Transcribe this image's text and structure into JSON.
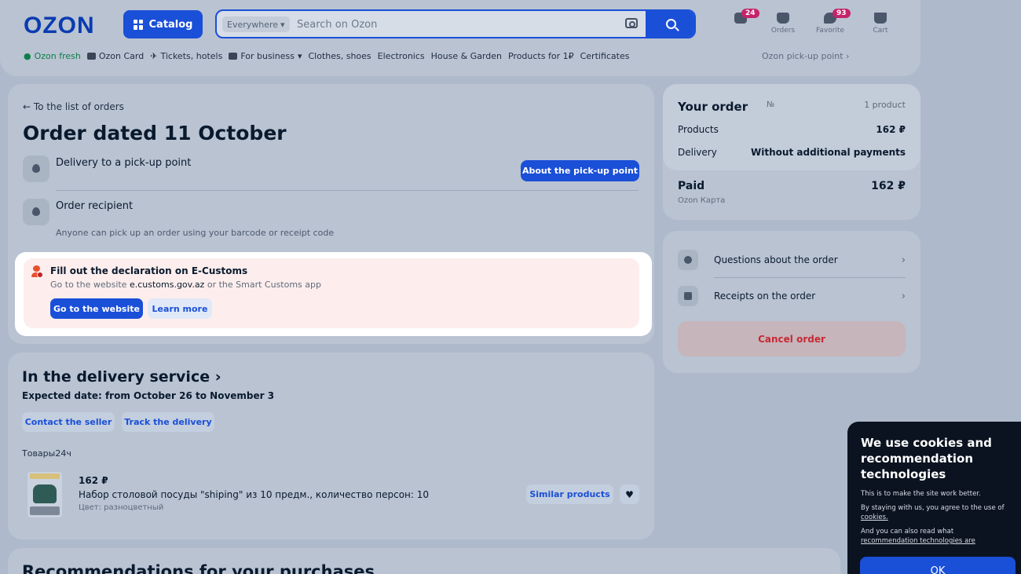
{
  "header": {
    "logo": "OZON",
    "catalog_label": "Catalog",
    "search_scope": "Everywhere",
    "search_placeholder": "Search on Ozon",
    "icons": [
      {
        "label": "",
        "badge": "24",
        "icon": "chat-icon"
      },
      {
        "label": "Orders",
        "badge": "",
        "icon": "box-icon"
      },
      {
        "label": "Favorite",
        "badge": "93",
        "icon": "heart-icon"
      },
      {
        "label": "Cart",
        "badge": "",
        "icon": "cart-icon"
      }
    ],
    "nav": [
      "Ozon fresh",
      "Ozon Card",
      "Tickets, hotels",
      "For business",
      "Clothes, shoes",
      "Electronics",
      "House & Garden",
      "Products for 1₽",
      "Certificates"
    ],
    "pickup": "Ozon pick-up point"
  },
  "order": {
    "back": "To the list of orders",
    "title": "Order dated 11 October",
    "delivery_label": "Delivery to a pick-up point",
    "about_button": "About the pick-up point",
    "recipient_label": "Order recipient",
    "recipient_sub": "Anyone can pick up an order using your barcode or receipt code"
  },
  "customs": {
    "title": "Fill out the declaration on E-Customs",
    "desc_pre": "Go to the website",
    "desc_site": "e.customs.gov.az",
    "desc_post": "or the Smart Customs app",
    "go_button": "Go to the website",
    "learn_button": "Learn more"
  },
  "summary": {
    "title": "Your order",
    "number_label": "№",
    "count": "1 product",
    "products_label": "Products",
    "products_value": "162 ₽",
    "delivery_label": "Delivery",
    "delivery_value": "Without additional payments",
    "paid_label": "Paid",
    "paid_value": "162 ₽",
    "paid_method": "Ozon Карта"
  },
  "help": {
    "questions": "Questions about the order",
    "receipts": "Receipts on the order",
    "cancel": "Cancel order"
  },
  "delivery": {
    "title": "In the delivery service",
    "date": "Expected date: from October 26 to November 3",
    "contact_button": "Contact the seller",
    "track_button": "Track the delivery",
    "shop": "Товары24ч",
    "price": "162 ₽",
    "name": "Набор столовой посуды \"shiping\" из 10 предм., количество персон: 10",
    "color": "Цвет: разноцветный",
    "similar_button": "Similar products"
  },
  "recs": {
    "title": "Recommendations for your purchases"
  },
  "cookie": {
    "title": "We use cookies and recommendation technologies",
    "line1": "This is to make the site work better.",
    "line2_pre": "By staying with us, you agree to the use of",
    "line2_link": "cookies.",
    "line3_pre": "And you can also read what",
    "line3_link": "recommendation technologies are",
    "ok": "OK"
  }
}
